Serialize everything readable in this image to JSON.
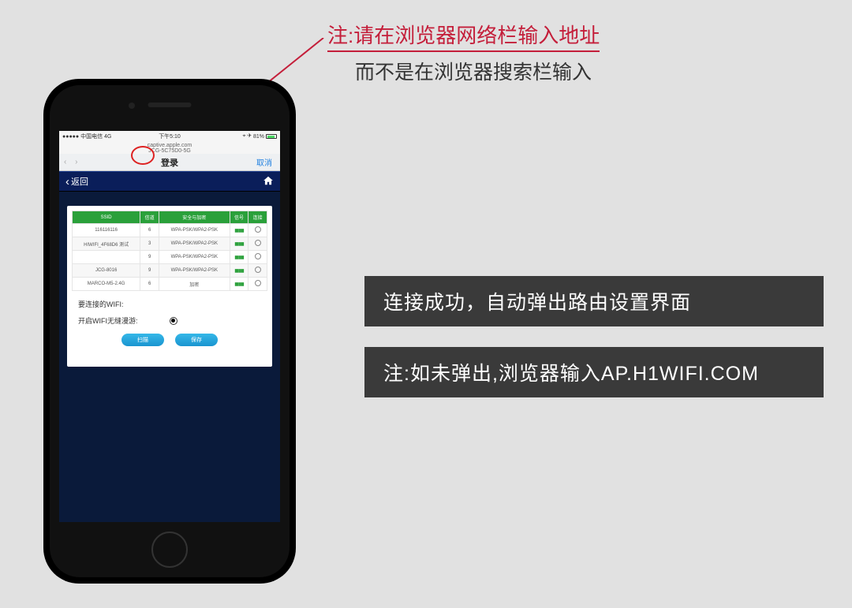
{
  "annotation": {
    "line1": "注:请在浏览器网络栏输入地址",
    "line2": "而不是在浏览器搜索栏输入"
  },
  "statusbar": {
    "carrier": "●●●●● 中国电信  4G",
    "time": "下午5:10",
    "battery_pct": "81%",
    "extra": "⌖ ✈"
  },
  "urlbar": {
    "domain": "captive.apple.com",
    "ssid": "JCG-5C75D0-5G"
  },
  "navbar": {
    "arrows": "‹  ›",
    "title": "登录",
    "cancel": "取消"
  },
  "appbar": {
    "back": "返回"
  },
  "table": {
    "headers": [
      "SSID",
      "信道",
      "安全与加密",
      "信号",
      "连接"
    ],
    "rows": [
      {
        "ssid": "116116116",
        "ch": "6",
        "sec": "WPA-PSK/WPA2-PSK",
        "sig": "▮▮▮▮▮"
      },
      {
        "ssid": "HIWIFI_4F68D6 测试",
        "ch": "3",
        "sec": "WPA-PSK/WPA2-PSK",
        "sig": "▮▮▮▮▮"
      },
      {
        "ssid": "",
        "ch": "9",
        "sec": "WPA-PSK/WPA2-PSK",
        "sig": "▮▮▮▮▮"
      },
      {
        "ssid": "JCG-8016",
        "ch": "9",
        "sec": "WPA-PSK/WPA2-PSK",
        "sig": "▮▮▮▮▮"
      },
      {
        "ssid": "MARCO-M5-2.4G",
        "ch": "6",
        "sec": "加密",
        "sig": "▮▮▮▮▮"
      }
    ]
  },
  "form": {
    "wifi_label": "要连接的WIFI:",
    "roam_label": "开启WIFI无缝漫游:"
  },
  "buttons": {
    "scan": "扫描",
    "save": "保存"
  },
  "callouts": {
    "c1": "连接成功，自动弹出路由设置界面",
    "c2": "注:如未弹出,浏览器输入AP.H1WIFI.COM"
  }
}
